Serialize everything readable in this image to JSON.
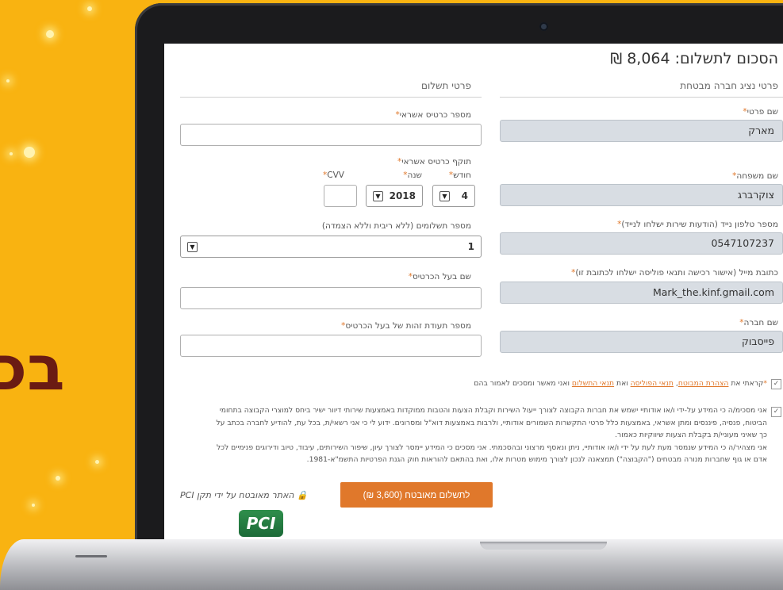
{
  "background": {
    "color": "#f9b311",
    "big_word": "בכ"
  },
  "page": {
    "title": "הסכום לתשלום: 8,064 ₪",
    "accent_color": "#e0782b"
  },
  "agent_section": {
    "heading": "פרטי נציג חברה מבטחת",
    "first_name": {
      "label": "שם פרטי",
      "value": "מארק"
    },
    "last_name": {
      "label": "שם משפחה",
      "value": "צוקרברג"
    },
    "phone": {
      "label": "מספר טלפון נייד (הודעות שירות ישלחו לנייד)",
      "value": "0547107237"
    },
    "email": {
      "label": "כתובת מייל (אישור רכישה ותנאי פוליסה ישלחו לכתובת זו)",
      "value": "Mark_the.kinf.gmail.com"
    },
    "company": {
      "label": "שם חברה",
      "value": "פייסבוק"
    }
  },
  "payment_section": {
    "heading": "פרטי תשלום",
    "card_number": {
      "label": "מספר כרטיס אשראי",
      "value": ""
    },
    "expiry": {
      "label": "תוקף כרטיס אשראי",
      "month_label": "חודש",
      "month_value": "4",
      "year_label": "שנה",
      "year_value": "2018",
      "cvv_label": "CVV",
      "cvv_value": ""
    },
    "installments": {
      "label": "מספר תשלומים (ללא ריבית וללא הצמדה)",
      "value": "1"
    },
    "cardholder_name": {
      "label": "שם בעל הכרטיס",
      "value": ""
    },
    "cardholder_id": {
      "label": "מספר תעודת זהות של בעל הכרטיס",
      "value": ""
    }
  },
  "required_mark": "*",
  "consent1": {
    "prefix": "קראתי את",
    "link1": "הצהרת המבוטח",
    "sep1": ",",
    "link2": "תנאי הפוליסה",
    "sep2": "ואת",
    "link3": "תנאי התשלום",
    "suffix": "ואני מאשר ומסכים לאמור בהם"
  },
  "consent2": {
    "lines": [
      "אני מסכימ/ה כי המידע על-ידי ו/או אודותיי ישמש את חברות הקבוצה לצורך ייעול השירות וקבלת הצעות והטבות ממוקדות באמצעות שירותי דיוור ישיר ביחס למוצרי הקבוצה בתחומי",
      "הביטוח, פנסיה, פיננסים ומתן אשראי, באמצעות כלל פרטי התקשרות השמורים אודותיי, ולרבות באמצעות דוא\"ל ומסרונים. ידוע לי כי אני רשאי/ת, בכל עת, להודיע לחברה בכתב על",
      "כך שאיני מעוניי/ת בקבלת הצעות שיווקיות כאמור.",
      "אני מצהיר/ה כי המידע שנמסר מעת לעת על ידי ו/או אודותיי, ניתן ונאסף מרצוני ובהסכמתי. אני מסכים כי המידע יימסר לצורך עיון, שיפור השירותים, עיבוד, טיוב ודירוגים פנימיים לכל",
      "אדם או גוף שחברות מנורה מבטחים (\"הקבוצה\") תמצאנה לנכון לצורך מימוש מטרות אלו, ואת בהתאם להוראות חוק הגנת הפרטיות התשמ\"א-1981."
    ]
  },
  "pay_button": {
    "label": "לתשלום מאובטח (3,600 ₪)"
  },
  "security": {
    "text": "האתר מאובטח על ידי תקן PCI",
    "logo_text": "PCI"
  }
}
